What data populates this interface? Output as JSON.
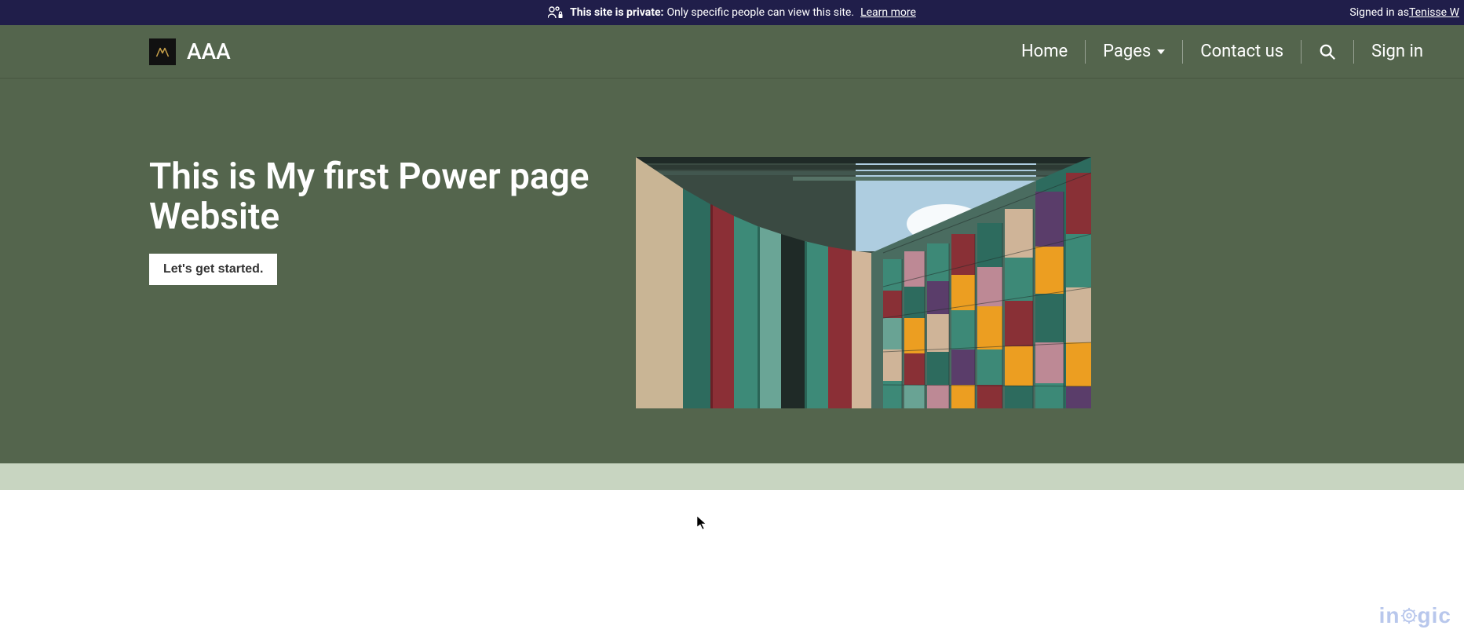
{
  "banner": {
    "private_prefix": "This site is private:",
    "private_msg": "Only specific people can view this site.",
    "learn_more": "Learn more",
    "signed_in_prefix": "Signed in as ",
    "signed_in_user": "Tenisse W"
  },
  "header": {
    "brand": "AAA",
    "nav": {
      "home": "Home",
      "pages": "Pages",
      "contact": "Contact us",
      "signin": "Sign in"
    }
  },
  "hero": {
    "title": "This is My first Power page Website",
    "cta": "Let's get started."
  },
  "footer": {
    "brand_text": "inogic"
  }
}
